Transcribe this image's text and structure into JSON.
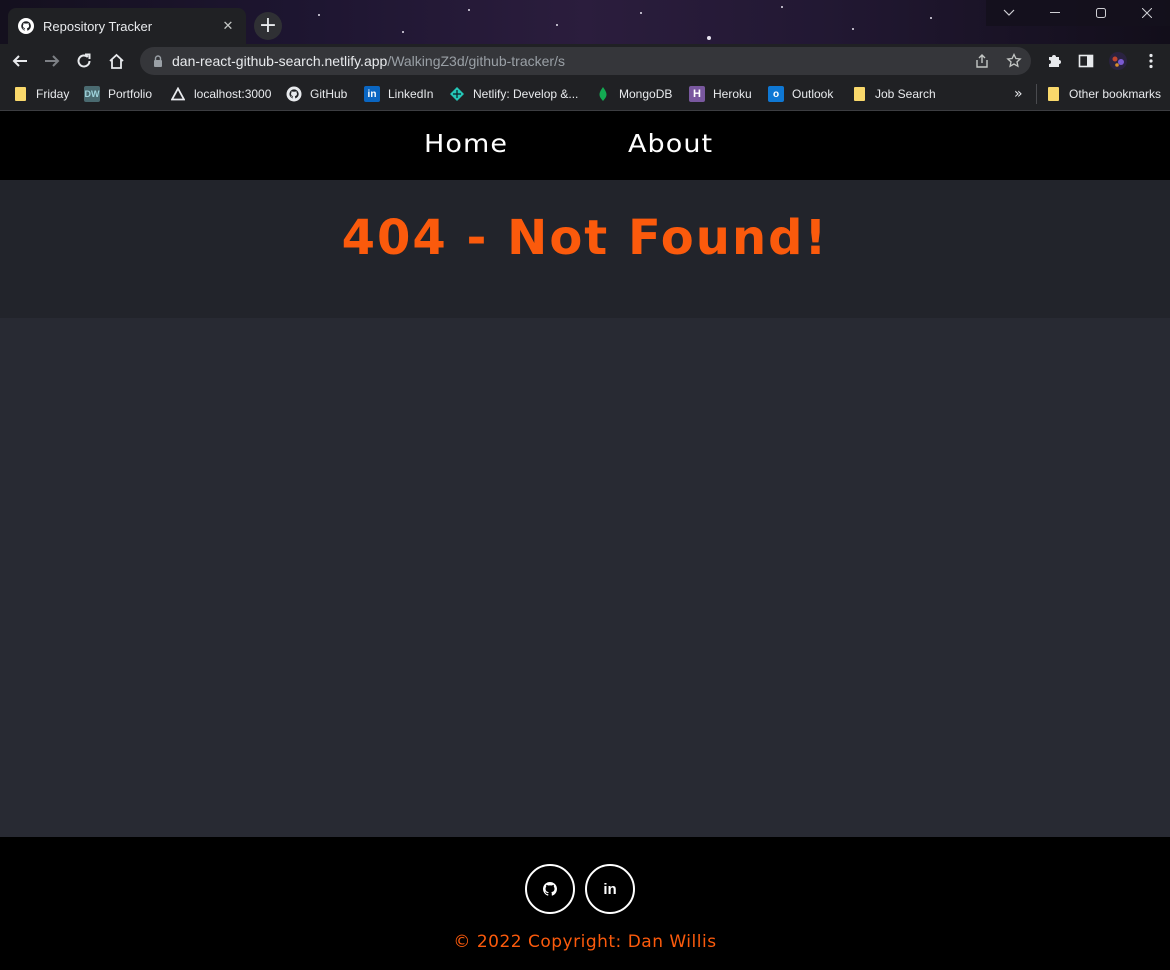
{
  "browser": {
    "tab": {
      "title": "Repository Tracker",
      "icon": "github-icon",
      "close_glyph": "✕"
    },
    "new_tab_glyph": "+",
    "url": {
      "host": "dan-react-github-search.netlify.app",
      "path": "/WalkingZ3d/github-tracker/s"
    },
    "bookmarks": [
      {
        "label": "Friday",
        "icon": "folder-icon"
      },
      {
        "label": "Portfolio",
        "icon": "dw-icon"
      },
      {
        "label": "localhost:3000",
        "icon": "triangle-icon"
      },
      {
        "label": "GitHub",
        "icon": "github-icon"
      },
      {
        "label": "LinkedIn",
        "icon": "linkedin-icon"
      },
      {
        "label": "Netlify: Develop &...",
        "icon": "netlify-icon"
      },
      {
        "label": "MongoDB",
        "icon": "mongodb-icon"
      },
      {
        "label": "Heroku",
        "icon": "heroku-icon"
      },
      {
        "label": "Outlook",
        "icon": "outlook-icon"
      },
      {
        "label": "Job Search",
        "icon": "folder-icon"
      }
    ],
    "overflow_glyph": "»",
    "other_bookmarks": "Other bookmarks"
  },
  "nav": {
    "home": "Home",
    "about": "About"
  },
  "hero": {
    "title": "404 - Not Found!"
  },
  "footer": {
    "copyright": "© 2022 Copyright: Dan Willis",
    "social": [
      "github-icon",
      "linkedin-icon"
    ],
    "linkedin_glyph": "in"
  },
  "colors": {
    "accent": "#fb5a0c",
    "nav_bg": "#000000",
    "page_bg": "#282a33",
    "hero_bg": "#22242b"
  }
}
